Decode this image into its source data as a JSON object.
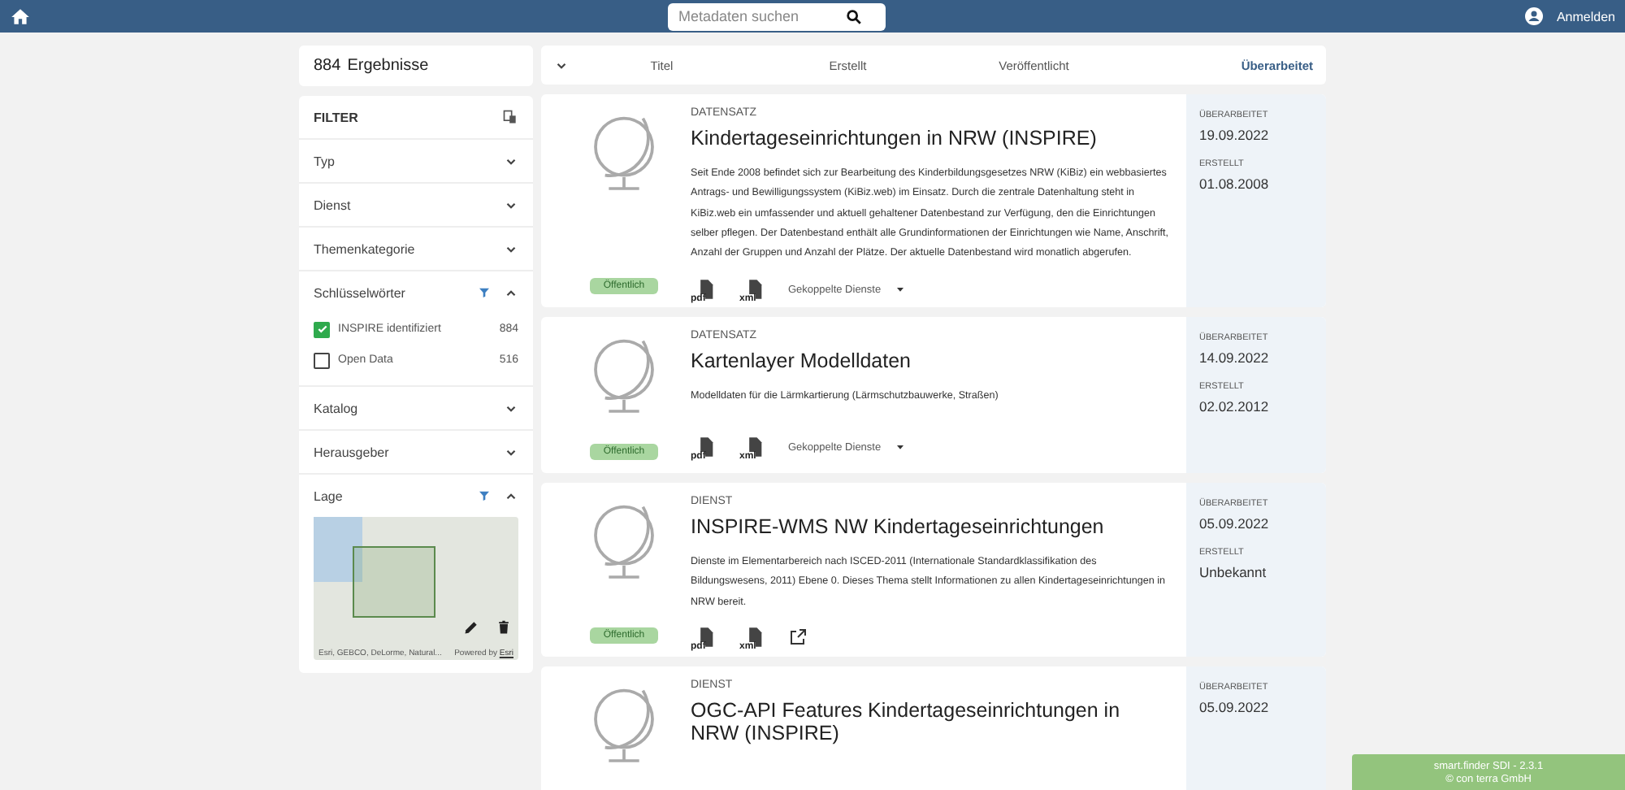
{
  "header": {
    "search": {
      "placeholder": "Metadaten suchen"
    },
    "login": "Anmelden"
  },
  "results": {
    "count": "884",
    "label": "Ergebnisse"
  },
  "filter": {
    "title": "FILTER",
    "sections": [
      {
        "label": "Typ",
        "expanded": false,
        "filter_active": false
      },
      {
        "label": "Dienst",
        "expanded": false,
        "filter_active": false
      },
      {
        "label": "Themenkategorie",
        "expanded": false,
        "filter_active": false
      },
      {
        "label": "Schlüsselwörter",
        "expanded": true,
        "filter_active": true,
        "kind": "checklist",
        "options": [
          {
            "label": "INSPIRE identifiziert",
            "count": "884",
            "checked": true
          },
          {
            "label": "Open Data",
            "count": "516",
            "checked": false
          }
        ]
      },
      {
        "label": "Katalog",
        "expanded": false,
        "filter_active": false
      },
      {
        "label": "Herausgeber",
        "expanded": false,
        "filter_active": false
      },
      {
        "label": "Lage",
        "expanded": true,
        "filter_active": true,
        "kind": "map",
        "attribution": "Esri, GEBCO, DeLorme, Natural...",
        "powered_by": "Powered by",
        "powered_link": "Esri"
      }
    ]
  },
  "sort_bar": {
    "options": [
      {
        "label": "Titel",
        "selected": false
      },
      {
        "label": "Erstellt",
        "selected": false
      },
      {
        "label": "Veröffentlicht",
        "selected": false
      },
      {
        "label": "Überarbeitet",
        "selected": true
      }
    ]
  },
  "results_list": [
    {
      "kind": "DATENSATZ",
      "title": "Kindertageseinrichtungen in NRW (INSPIRE)",
      "description": "Seit Ende 2008 befindet sich zur Bearbeitung des Kinderbildungsgesetzes NRW (KiBiz) ein webbasiertes Antrags- und Bewilligungssystem (KiBiz.web) im Einsatz. Durch die zentrale Datenhaltung steht in KiBiz.web ein umfassender und aktuell gehaltener Datenbestand zur Verfügung, den die Einrichtungen selber pflegen. Der Datenbestand enthält alle Grundinformationen der Einrichtungen wie Name, Anschrift, Anzahl der Gruppen und Anzahl der Plätze. Der aktuelle Datenbestand wird monatlich abgerufen.",
      "access": "Öffentlich",
      "actions": [
        {
          "kind": "pdf",
          "label": "pdf"
        },
        {
          "kind": "xml",
          "label": "xml"
        },
        {
          "kind": "services",
          "label": "Gekoppelte Dienste"
        }
      ],
      "dates": [
        {
          "label": "ÜBERARBEITET",
          "value": "19.09.2022"
        },
        {
          "label": "ERSTELLT",
          "value": "01.08.2008"
        }
      ]
    },
    {
      "kind": "DATENSATZ",
      "title": "Kartenlayer Modelldaten",
      "description": "Modelldaten für die Lärmkartierung (Lärmschutzbauwerke, Straßen)",
      "access": "Öffentlich",
      "actions": [
        {
          "kind": "pdf",
          "label": "pdf"
        },
        {
          "kind": "xml",
          "label": "xml"
        },
        {
          "kind": "services",
          "label": "Gekoppelte Dienste"
        }
      ],
      "dates": [
        {
          "label": "ÜBERARBEITET",
          "value": "14.09.2022"
        },
        {
          "label": "ERSTELLT",
          "value": "02.02.2012"
        }
      ]
    },
    {
      "kind": "DIENST",
      "title": "INSPIRE-WMS NW Kindertageseinrichtungen",
      "description": "Dienste im Elementarbereich nach ISCED-2011 (Internationale Standardklassifikation des Bildungswesens, 2011) Ebene 0. Dieses Thema stellt Informationen zu allen Kindertageseinrichtungen in NRW bereit.",
      "access": "Öffentlich",
      "actions": [
        {
          "kind": "pdf",
          "label": "pdf"
        },
        {
          "kind": "xml",
          "label": "xml"
        },
        {
          "kind": "link"
        }
      ],
      "dates": [
        {
          "label": "ÜBERARBEITET",
          "value": "05.09.2022"
        },
        {
          "label": "ERSTELLT",
          "value": "Unbekannt"
        }
      ]
    },
    {
      "kind": "DIENST",
      "title": "OGC-API Features Kindertageseinrichtungen in NRW (INSPIRE)",
      "dates": [
        {
          "label": "ÜBERARBEITET",
          "value": "05.09.2022"
        }
      ]
    }
  ],
  "version_badge": {
    "product": "smart.finder SDI - 2.3.1",
    "copyright": "© con terra GmbH"
  }
}
